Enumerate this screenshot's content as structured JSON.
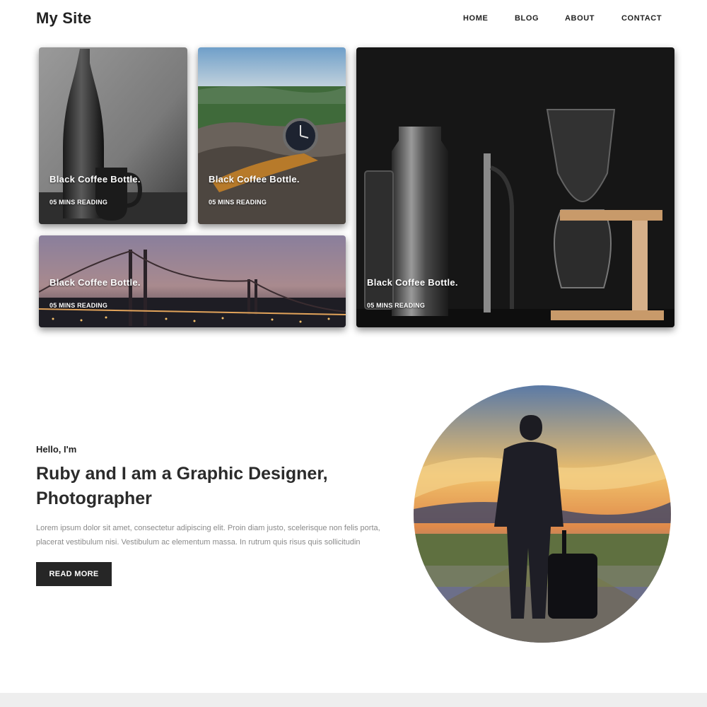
{
  "header": {
    "brand": "My Site",
    "nav": [
      {
        "label": "HOME"
      },
      {
        "label": "BLOG"
      },
      {
        "label": "ABOUT"
      },
      {
        "label": "CONTACT"
      }
    ]
  },
  "featured": {
    "cards": [
      {
        "title": "Black Coffee Bottle.",
        "meta": "05 MINS READING",
        "image": "black-bottle-and-cup-photo"
      },
      {
        "title": "Black Coffee Bottle.",
        "meta": "05 MINS READING",
        "image": "wristwatch-on-rock-landscape-photo"
      },
      {
        "title": "Black Coffee Bottle.",
        "meta": "05 MINS READING",
        "image": "bridge-city-lights-dusk-photo"
      },
      {
        "title": "Black Coffee Bottle.",
        "meta": "05 MINS READING",
        "image": "cocktail-shaker-and-glassware-photo"
      }
    ]
  },
  "intro": {
    "eyebrow": "Hello, I'm",
    "heading": "Ruby and I am a Graphic Designer, Photographer",
    "body": "Lorem ipsum dolor sit amet, consectetur adipiscing elit. Proin diam justo, scelerisque non felis porta, placerat vestibulum nisi. Vestibulum ac elementum massa. In rutrum quis risus quis sollicitudin",
    "button_label": "READ MORE",
    "portrait_image": "traveler-with-suitcase-sunset-photo"
  },
  "colors": {
    "text_dark": "#222222",
    "button_bg": "#262626",
    "body_text": "#8a8a8a",
    "footer_band": "#eeeeee"
  }
}
